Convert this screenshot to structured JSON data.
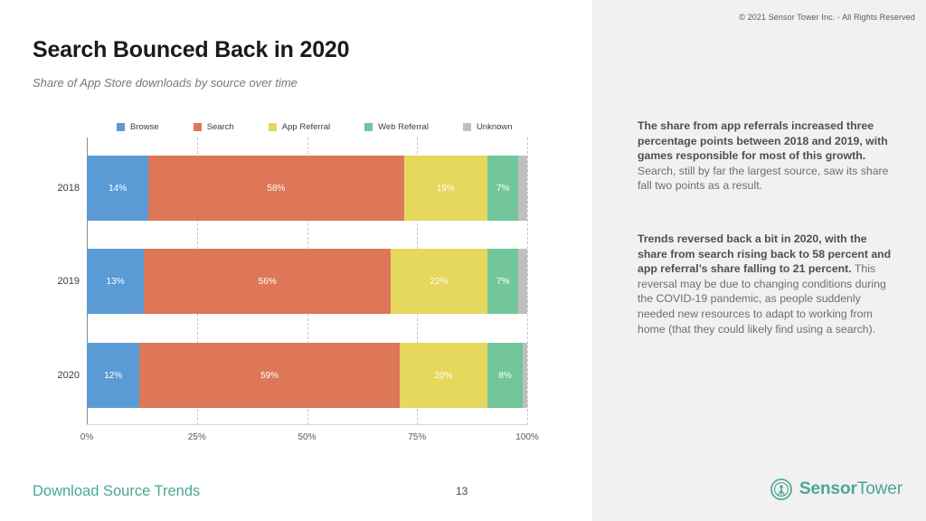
{
  "copyright": "© 2021 Sensor Tower Inc. - All Rights Reserved",
  "title": "Search Bounced Back in 2020",
  "subtitle": "Share of App Store downloads by source over time",
  "footer": {
    "section_label": "Download Source Trends",
    "page_number": "13",
    "brand_bold": "Sensor",
    "brand_regular": "Tower",
    "brand_mark_name": "sensor-tower-logo-icon"
  },
  "insights": [
    {
      "bold": "The share from app referrals increased three percentage points between 2018 and 2019, with games responsible for most of this growth.",
      "rest": " Search, still by far the largest source, saw its share fall two points as a result."
    },
    {
      "bold": "Trends reversed back a bit in 2020, with the share from search rising back to 58 percent and app referral’s share falling to 21 percent.",
      "rest": " This reversal may be due to changing conditions during the COVID-19 pandemic, as people suddenly needed new resources to adapt to working from home (that they could likely find using a search)."
    }
  ],
  "chart_data": {
    "type": "bar",
    "orientation": "horizontal",
    "stacked": true,
    "stack_mode": "percent",
    "title": "Share of App Store downloads by source over time",
    "xlabel": "",
    "ylabel": "",
    "xlim": [
      0,
      100
    ],
    "xticks": [
      "0%",
      "25%",
      "50%",
      "75%",
      "100%"
    ],
    "xtick_values": [
      0,
      25,
      50,
      75,
      100
    ],
    "grid": true,
    "legend_position": "top",
    "categories": [
      "2018",
      "2019",
      "2020"
    ],
    "series": [
      {
        "name": "Browse",
        "color": "#5b9bd5",
        "values": [
          14,
          13,
          12
        ],
        "labels": [
          "14%",
          "13%",
          "12%"
        ]
      },
      {
        "name": "Search",
        "color": "#dd7757",
        "values": [
          58,
          56,
          59
        ],
        "labels": [
          "58%",
          "56%",
          "59%"
        ]
      },
      {
        "name": "App Referral",
        "color": "#e5d85c",
        "values": [
          19,
          22,
          20
        ],
        "labels": [
          "19%",
          "22%",
          "20%"
        ]
      },
      {
        "name": "Web Referral",
        "color": "#72c69a",
        "values": [
          7,
          7,
          8
        ],
        "labels": [
          "7%",
          "7%",
          "8%"
        ]
      },
      {
        "name": "Unknown",
        "color": "#bfbfbf",
        "values": [
          2,
          2,
          1
        ],
        "labels": [
          "",
          "",
          ""
        ]
      }
    ]
  },
  "colors": {
    "browse": "#5b9bd5",
    "search": "#dd7757",
    "app_referral": "#e5d85c",
    "web_referral": "#72c69a",
    "unknown": "#bfbfbf",
    "brand_teal": "#4aa795",
    "right_panel_bg": "#f1f1f1"
  }
}
